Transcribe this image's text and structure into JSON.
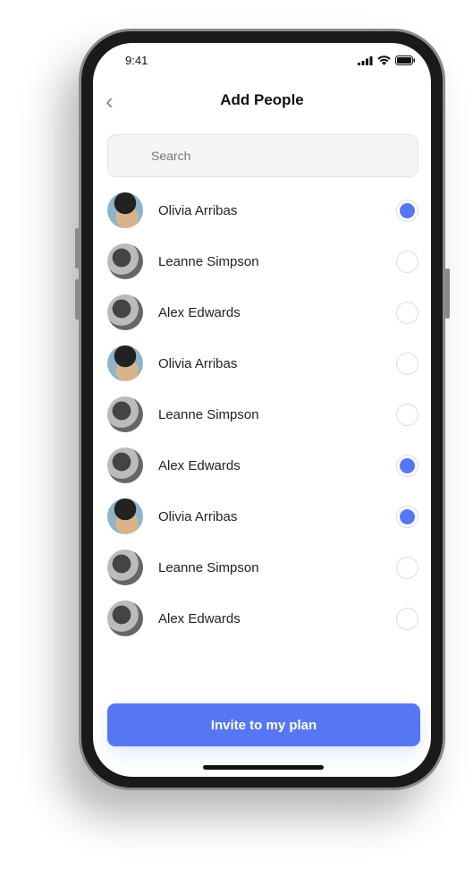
{
  "status_bar": {
    "time": "9:41"
  },
  "header": {
    "title": "Add People"
  },
  "search": {
    "placeholder": "Search"
  },
  "people": [
    {
      "name": "Olivia Arribas",
      "avatar": "olivia",
      "selected": true
    },
    {
      "name": "Leanne Simpson",
      "avatar": "gray",
      "selected": false
    },
    {
      "name": "Alex Edwards",
      "avatar": "gray",
      "selected": false
    },
    {
      "name": "Olivia Arribas",
      "avatar": "olivia",
      "selected": false
    },
    {
      "name": "Leanne Simpson",
      "avatar": "gray",
      "selected": false
    },
    {
      "name": "Alex Edwards",
      "avatar": "gray",
      "selected": true
    },
    {
      "name": "Olivia Arribas",
      "avatar": "olivia",
      "selected": true
    },
    {
      "name": "Leanne Simpson",
      "avatar": "gray",
      "selected": false
    },
    {
      "name": "Alex Edwards",
      "avatar": "gray",
      "selected": false
    }
  ],
  "invite_button": {
    "label": "Invite to my plan"
  },
  "colors": {
    "accent": "#5677f5"
  }
}
